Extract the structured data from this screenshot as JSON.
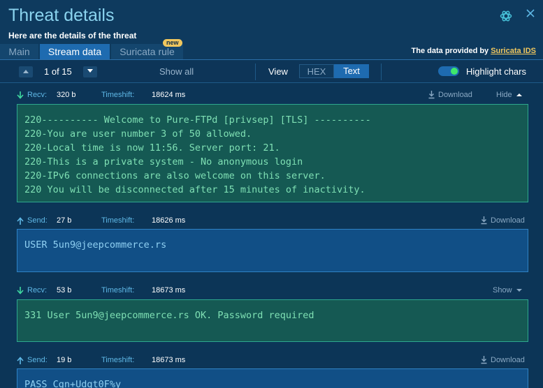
{
  "header": {
    "title": "Threat details",
    "subtitle": "Here are the details of the threat"
  },
  "tabs": [
    {
      "label": "Main"
    },
    {
      "label": "Stream data"
    },
    {
      "label": "Suricata rule"
    }
  ],
  "new_badge": "new",
  "provider": {
    "prefix": "The data provided by",
    "link": "Suricata IDS"
  },
  "toolbar": {
    "pager": "1 of 15",
    "show_all": "Show all",
    "view_label": "View",
    "hex": "HEX",
    "text": "Text",
    "highlight_label": "Highlight chars",
    "highlight_on": true
  },
  "common": {
    "timeshift_label": "Timeshift:",
    "download": "Download"
  },
  "messages": [
    {
      "direction": "Recv:",
      "size": "320 b",
      "timeshift": "18624 ms",
      "toggle": "Hide",
      "content": "220---------- Welcome to Pure-FTPd [privsep] [TLS] ----------\n220-You are user number 3 of 50 allowed.\n220-Local time is now 11:56. Server port: 21.\n220-This is a private system - No anonymous login\n220-IPv6 connections are also welcome on this server.\n220 You will be disconnected after 15 minutes of inactivity."
    },
    {
      "direction": "Send:",
      "size": "27 b",
      "timeshift": "18626 ms",
      "content": "USER 5un9@jeepcommerce.rs"
    },
    {
      "direction": "Recv:",
      "size": "53 b",
      "timeshift": "18673 ms",
      "toggle": "Show",
      "content": "331 User 5un9@jeepcommerce.rs OK. Password required"
    },
    {
      "direction": "Send:",
      "size": "19 b",
      "timeshift": "18673 ms",
      "content": "PASS Cgn+Udgt0F%y"
    }
  ],
  "colors": {
    "recv_bg": "#155953",
    "send_bg": "#114f86",
    "accent": "#1e6bb0",
    "highlight": "#3fe86b"
  }
}
